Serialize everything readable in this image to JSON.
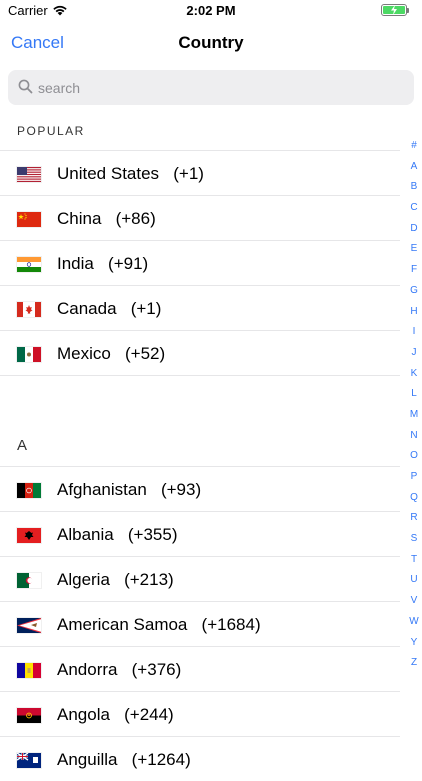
{
  "status": {
    "carrier": "Carrier",
    "time": "2:02 PM"
  },
  "nav": {
    "cancel": "Cancel",
    "title": "Country"
  },
  "search": {
    "placeholder": "search"
  },
  "sections": [
    {
      "header": "POPULAR",
      "rows": [
        {
          "label": "United States   (+1)",
          "flag": "us"
        },
        {
          "label": "China   (+86)",
          "flag": "cn"
        },
        {
          "label": "India   (+91)",
          "flag": "in"
        },
        {
          "label": "Canada   (+1)",
          "flag": "ca"
        },
        {
          "label": "Mexico   (+52)",
          "flag": "mx"
        }
      ]
    },
    {
      "header": "A",
      "rows": [
        {
          "label": "Afghanistan   (+93)",
          "flag": "af"
        },
        {
          "label": "Albania   (+355)",
          "flag": "al"
        },
        {
          "label": "Algeria   (+213)",
          "flag": "dz"
        },
        {
          "label": "American Samoa   (+1684)",
          "flag": "as"
        },
        {
          "label": "Andorra   (+376)",
          "flag": "ad"
        },
        {
          "label": "Angola   (+244)",
          "flag": "ao"
        },
        {
          "label": "Anguilla   (+1264)",
          "flag": "ai"
        }
      ]
    }
  ],
  "index": [
    "#",
    "A",
    "B",
    "C",
    "D",
    "E",
    "F",
    "G",
    "H",
    "I",
    "J",
    "K",
    "L",
    "M",
    "N",
    "O",
    "P",
    "Q",
    "R",
    "S",
    "T",
    "U",
    "V",
    "W",
    "Y",
    "Z"
  ],
  "colors": {
    "accent": "#3478f6",
    "battery": "#4cd964"
  }
}
